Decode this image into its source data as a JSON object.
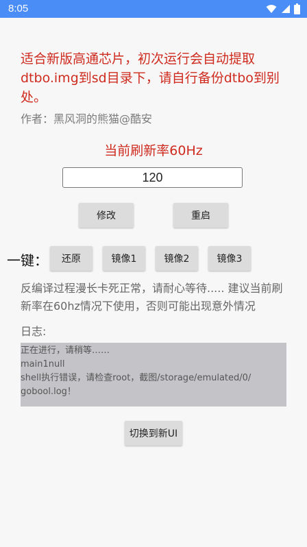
{
  "status_bar": {
    "time": "8:05",
    "icons": [
      "wifi-icon",
      "signal-icon",
      "battery-icon"
    ]
  },
  "notice": "适合新版高通芯片，初次运行会自动提取dtbo.img到sd目录下，请自行备份dtbo到别处。",
  "author": "作者：黑风洞的熊猫@酷安",
  "current_rate_label": "当前刷新率60Hz",
  "rate_input": {
    "value": "120"
  },
  "buttons": {
    "modify": "修改",
    "restart": "重启",
    "restore": "还原",
    "mirror1": "镜像1",
    "mirror2": "镜像2",
    "mirror3": "镜像3",
    "switch_ui": "切换到新UI"
  },
  "one_key_label": "一键：",
  "description": "反编译过程漫长卡死正常，请耐心等待..... 建议当前刷新率在60hz情况下使用，否则可能出现意外情况",
  "log": {
    "label": "日志:",
    "lines": [
      "正在进行，请稍等……",
      "main1null",
      "shell执行错误，请检查root，截图/storage/emulated/0/",
      "gobool.log！"
    ]
  },
  "colors": {
    "status_bar": "#4a8df6",
    "accent_red": "#cf2a1e",
    "button_bg": "#dcdcdc",
    "log_bg": "#c4c4c8"
  }
}
